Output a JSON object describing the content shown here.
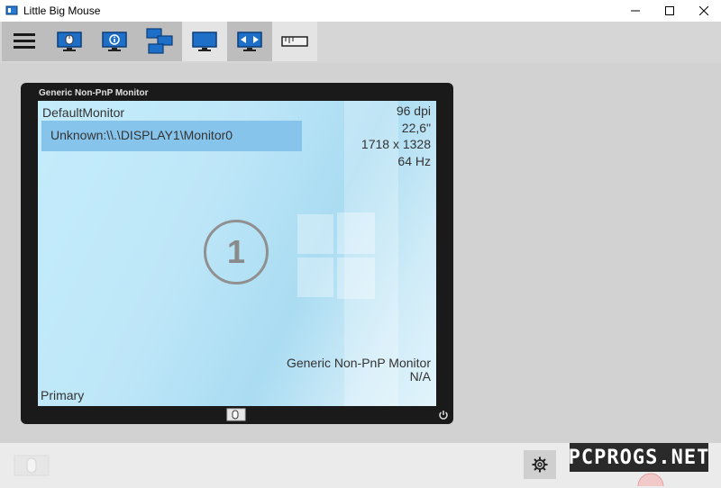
{
  "window": {
    "title": "Little Big Mouse",
    "controls": [
      "minimize-icon",
      "maximize-icon",
      "close-icon"
    ]
  },
  "toolbar": {
    "buttons": [
      {
        "icon": "menu-icon"
      },
      {
        "icon": "monitor-mouse-icon"
      },
      {
        "icon": "monitor-info-icon"
      },
      {
        "icon": "monitors-stack-icon"
      },
      {
        "icon": "monitor-icon"
      },
      {
        "icon": "monitor-arrows-icon"
      },
      {
        "icon": "ruler-icon"
      }
    ]
  },
  "monitor": {
    "bezel_title": "Generic Non-PnP Monitor",
    "name": "DefaultMonitor",
    "device_id": "Unknown:\\\\.\\DISPLAY1\\Monitor0",
    "dpi": "96 dpi",
    "size": "22,6\"",
    "resolution": "1718 x 1328",
    "frequency": "64 Hz",
    "number": "1",
    "model": "Generic Non-PnP Monitor",
    "serial": "N/A",
    "primary_label": "Primary"
  },
  "footer": {
    "gear": "gear-icon"
  },
  "watermark": {
    "text": "PCPROGS.NET"
  },
  "colors": {
    "accent": "#1e6fc8",
    "selection": "#86c4ec",
    "bezel": "#1a1a1a"
  }
}
